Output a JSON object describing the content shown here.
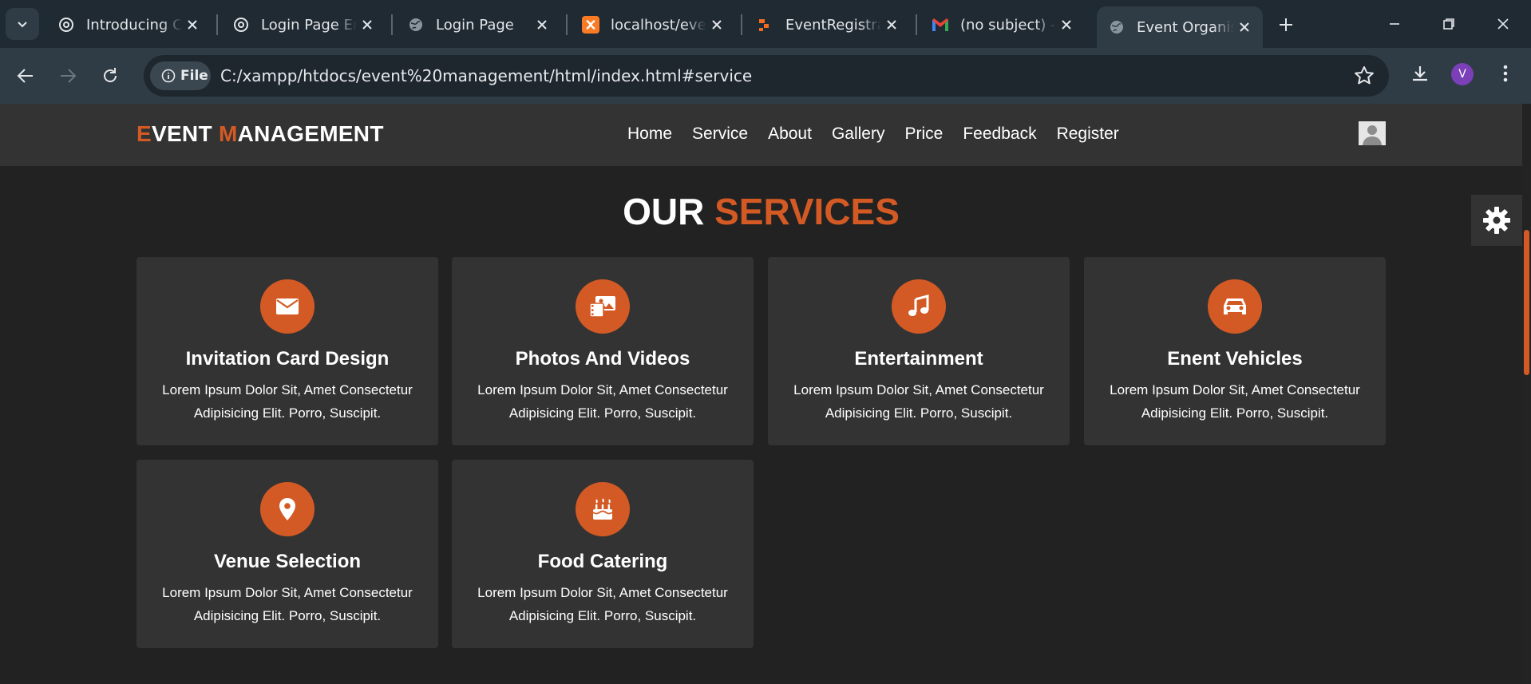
{
  "browser": {
    "tabs": [
      {
        "title": "Introducing ChatGPT",
        "icon": "openai-icon"
      },
      {
        "title": "Login Page Embed",
        "icon": "openai-icon"
      },
      {
        "title": "Login Page",
        "icon": "globe-icon"
      },
      {
        "title": "localhost/event",
        "icon": "xampp-icon"
      },
      {
        "title": "EventRegistration",
        "icon": "phpmyadmin-icon"
      },
      {
        "title": "(no subject) - ",
        "icon": "gmail-icon"
      },
      {
        "title": "Event Organiser",
        "icon": "globe-icon",
        "active": true
      }
    ],
    "address": {
      "chip_label": "File",
      "url": "C:/xampp/htdocs/event%20management/html/index.html#service"
    },
    "profile_initial": "V"
  },
  "site": {
    "logo": {
      "first_initial": "E",
      "first_rest": "VENT ",
      "second_initial": "M",
      "second_rest": "ANAGEMENT"
    },
    "nav": [
      "Home",
      "Service",
      "About",
      "Gallery",
      "Price",
      "Feedback",
      "Register"
    ],
    "accent_color": "#d35a24"
  },
  "services": {
    "title_white": "OUR ",
    "title_accent": "SERVICES",
    "cards": [
      {
        "title": "Invitation Card Design",
        "desc": "Lorem Ipsum Dolor Sit, Amet Consectetur Adipisicing Elit. Porro, Suscipit.",
        "icon": "envelope-icon"
      },
      {
        "title": "Photos And Videos",
        "desc": "Lorem Ipsum Dolor Sit, Amet Consectetur Adipisicing Elit. Porro, Suscipit.",
        "icon": "photo-video-icon"
      },
      {
        "title": "Entertainment",
        "desc": "Lorem Ipsum Dolor Sit, Amet Consectetur Adipisicing Elit. Porro, Suscipit.",
        "icon": "music-icon"
      },
      {
        "title": "Enent Vehicles",
        "desc": "Lorem Ipsum Dolor Sit, Amet Consectetur Adipisicing Elit. Porro, Suscipit.",
        "icon": "car-icon"
      },
      {
        "title": "Venue Selection",
        "desc": "Lorem Ipsum Dolor Sit, Amet Consectetur Adipisicing Elit. Porro, Suscipit.",
        "icon": "map-marker-icon"
      },
      {
        "title": "Food Catering",
        "desc": "Lorem Ipsum Dolor Sit, Amet Consectetur Adipisicing Elit. Porro, Suscipit.",
        "icon": "birthday-cake-icon"
      }
    ]
  }
}
